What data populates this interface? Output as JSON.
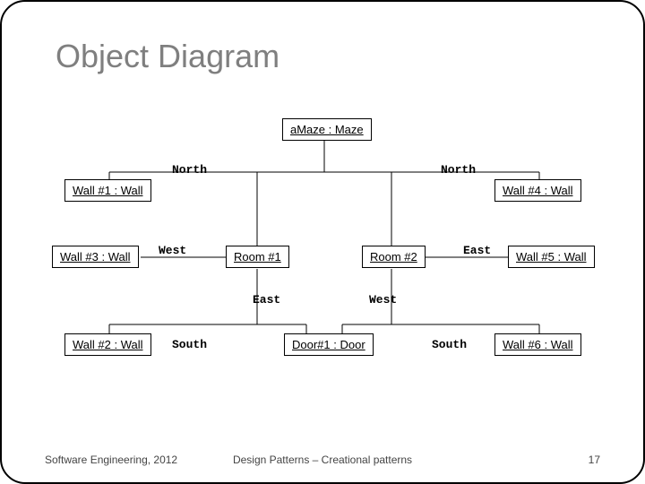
{
  "title": "Object Diagram",
  "objects": {
    "maze": "aMaze : Maze",
    "wall1": "Wall #1 : Wall",
    "wall2": "Wall #2 : Wall",
    "wall3": "Wall #3 : Wall",
    "wall4": "Wall #4 : Wall",
    "wall5": "Wall #5 : Wall",
    "wall6": "Wall #6 : Wall",
    "room1": "Room #1",
    "room2": "Room #2",
    "door1": "Door#1 : Door"
  },
  "labels": {
    "north1": "North",
    "north2": "North",
    "west": "West",
    "east": "East",
    "east2": "East",
    "west2": "West",
    "south1": "South",
    "south2": "South"
  },
  "footer": {
    "left": "Software Engineering, 2012",
    "center": "Design Patterns – Creational patterns",
    "right": "17"
  }
}
